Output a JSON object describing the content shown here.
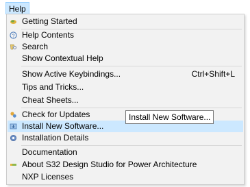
{
  "menubar": {
    "help_label": "Help"
  },
  "menu": {
    "items": [
      {
        "label": "Getting Started",
        "icon": "getting-started-icon"
      },
      {
        "label": "Help Contents",
        "icon": "help-contents-icon"
      },
      {
        "label": "Search",
        "icon": "search-icon"
      },
      {
        "label": "Show Contextual Help"
      },
      {
        "label": "Show Active Keybindings...",
        "accelerator": "Ctrl+Shift+L"
      },
      {
        "label": "Tips and Tricks..."
      },
      {
        "label": "Cheat Sheets..."
      },
      {
        "label": "Check for Updates",
        "icon": "check-updates-icon"
      },
      {
        "label": "Install New Software...",
        "icon": "install-software-icon",
        "highlighted": true
      },
      {
        "label": "Installation Details",
        "icon": "installation-details-icon"
      },
      {
        "label": "Documentation"
      },
      {
        "label": "About S32 Design Studio for Power Architecture",
        "icon": "about-icon"
      },
      {
        "label": "NXP Licenses"
      }
    ]
  },
  "tooltip": {
    "text": "Install New Software..."
  },
  "colors": {
    "menu_bg": "#f2f2f2",
    "highlight": "#cce8ff",
    "menubar_highlight": "#cce8ff"
  }
}
